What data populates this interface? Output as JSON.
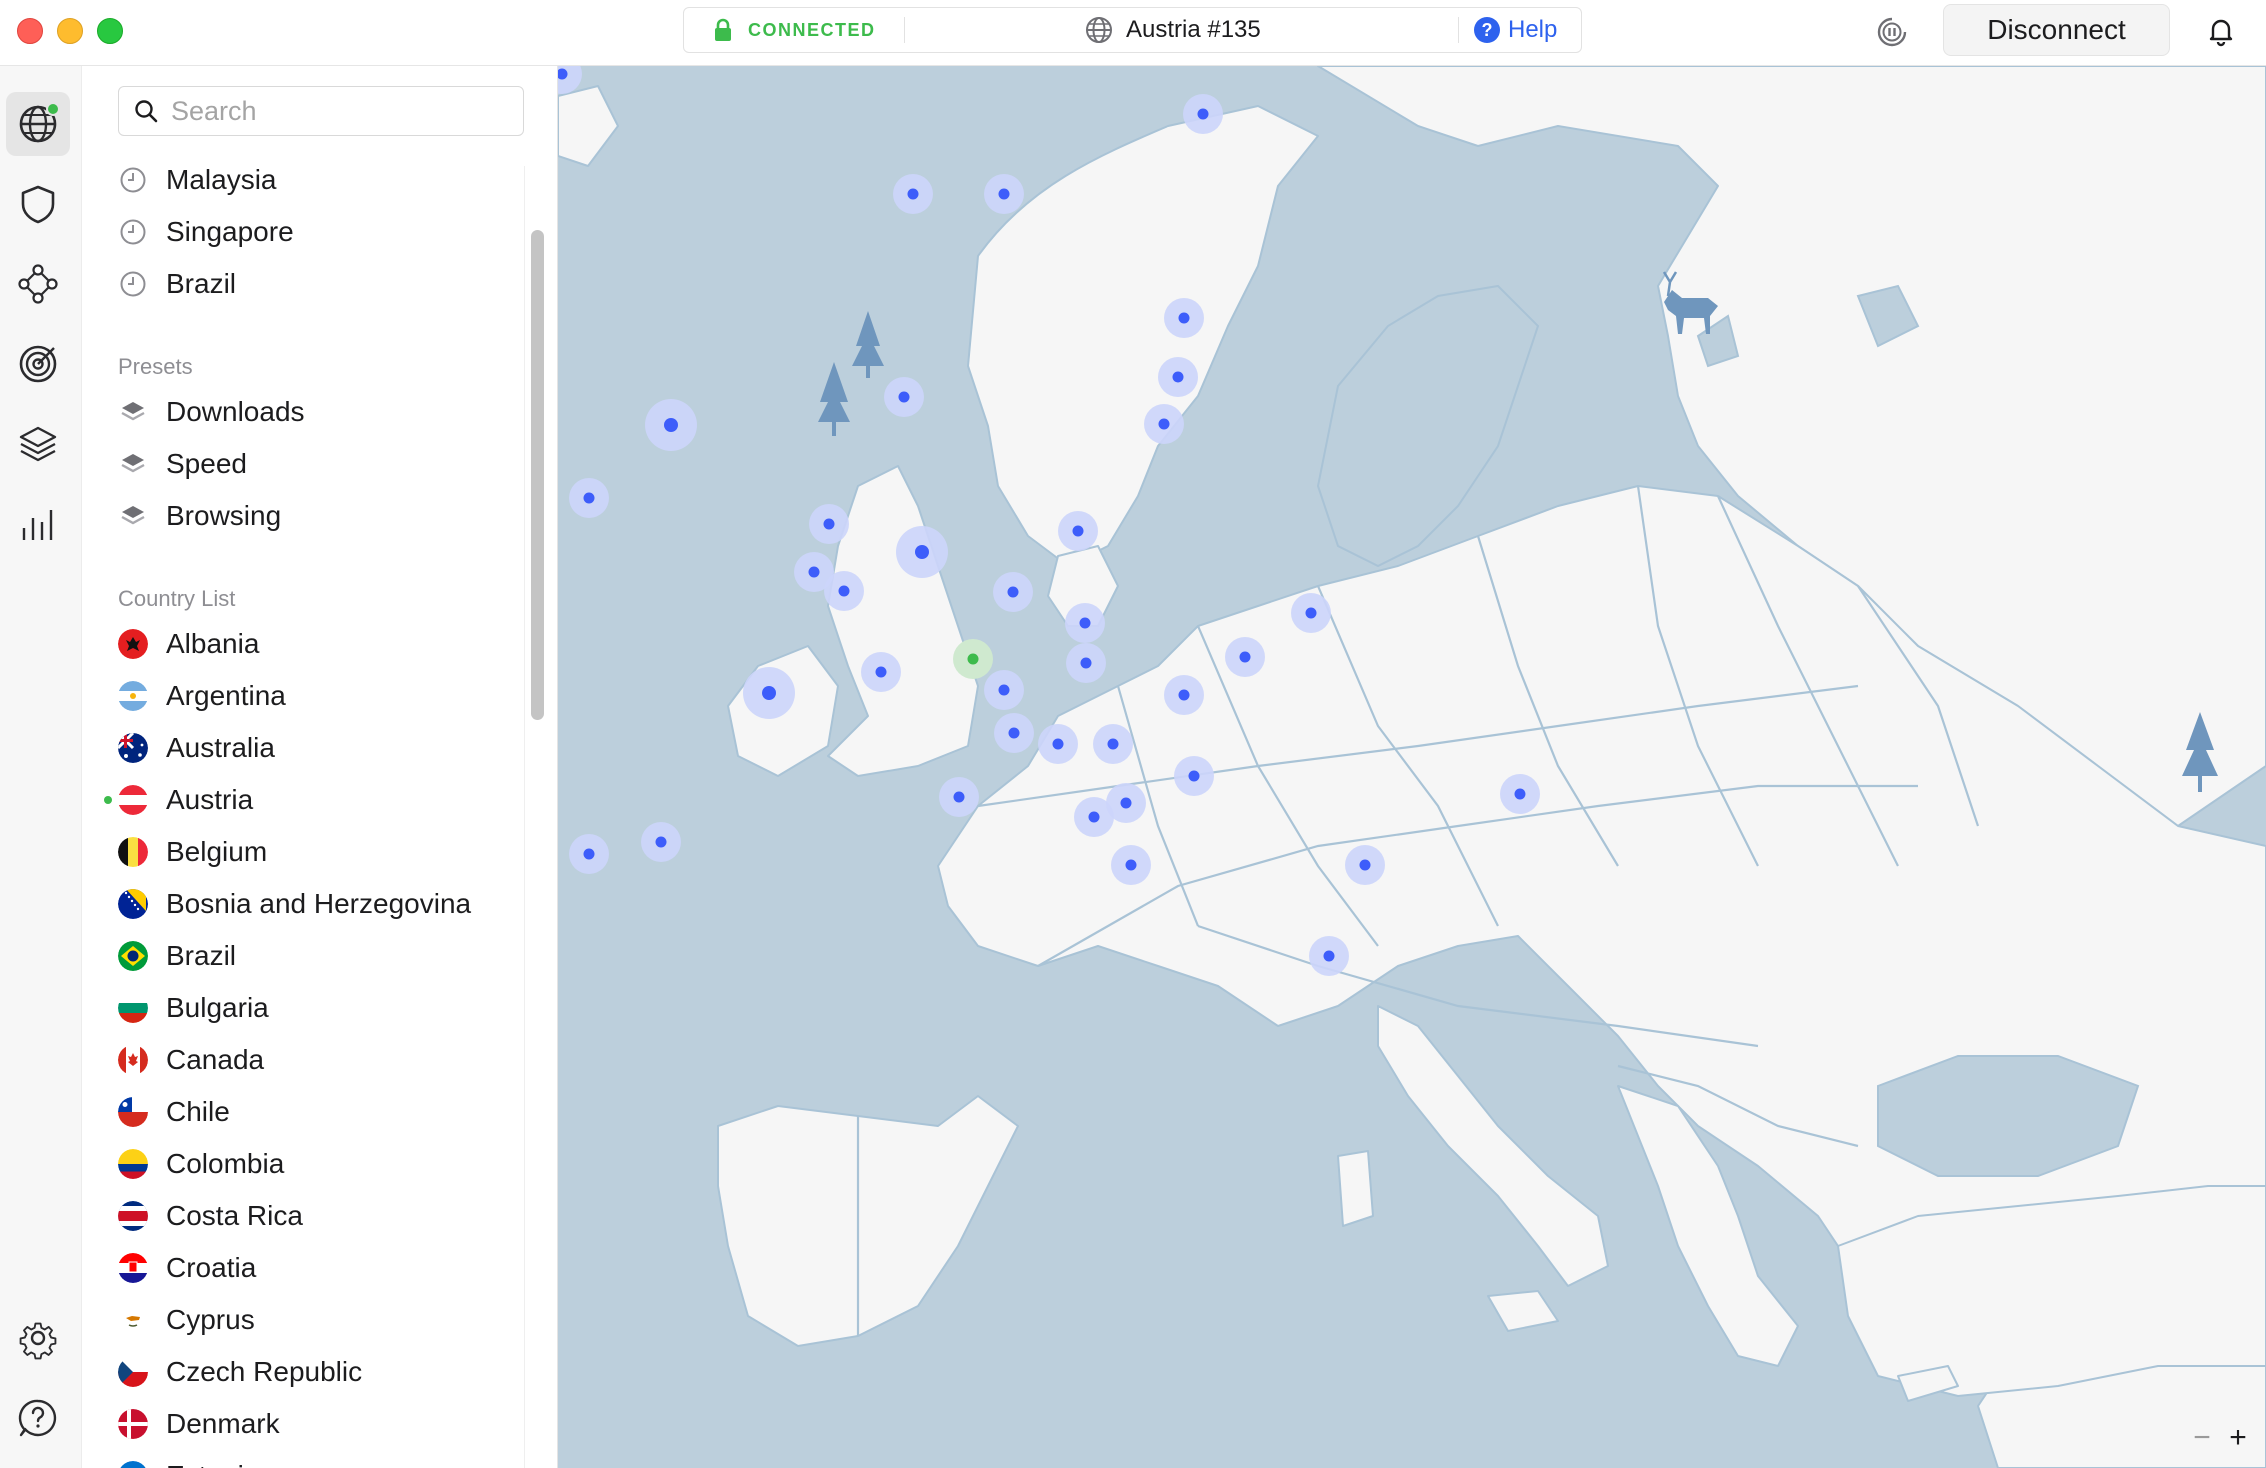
{
  "window": {
    "status_label": "CONNECTED",
    "server_name": "Austria #135",
    "help_label": "Help",
    "disconnect_label": "Disconnect"
  },
  "rail": {
    "items": [
      "globe-icon",
      "shield-icon",
      "meshnet-icon",
      "target-icon",
      "layers-icon",
      "stats-icon"
    ],
    "bottom": [
      "gear-icon",
      "help-icon"
    ]
  },
  "search": {
    "placeholder": "Search",
    "value": ""
  },
  "recent": [
    {
      "label": "Malaysia"
    },
    {
      "label": "Singapore"
    },
    {
      "label": "Brazil"
    }
  ],
  "presets_title": "Presets",
  "presets": [
    {
      "label": "Downloads"
    },
    {
      "label": "Speed"
    },
    {
      "label": "Browsing"
    }
  ],
  "country_list_title": "Country List",
  "countries": [
    {
      "label": "Albania",
      "flag": "al"
    },
    {
      "label": "Argentina",
      "flag": "ar"
    },
    {
      "label": "Australia",
      "flag": "au"
    },
    {
      "label": "Austria",
      "flag": "at",
      "connected": true
    },
    {
      "label": "Belgium",
      "flag": "be"
    },
    {
      "label": "Bosnia and Herzegovina",
      "flag": "ba"
    },
    {
      "label": "Brazil",
      "flag": "br"
    },
    {
      "label": "Bulgaria",
      "flag": "bg"
    },
    {
      "label": "Canada",
      "flag": "ca"
    },
    {
      "label": "Chile",
      "flag": "cl"
    },
    {
      "label": "Colombia",
      "flag": "co"
    },
    {
      "label": "Costa Rica",
      "flag": "cr"
    },
    {
      "label": "Croatia",
      "flag": "hr"
    },
    {
      "label": "Cyprus",
      "flag": "cy"
    },
    {
      "label": "Czech Republic",
      "flag": "cz"
    },
    {
      "label": "Denmark",
      "flag": "dk"
    },
    {
      "label": "Estonia",
      "flag": "ee"
    }
  ],
  "colors": {
    "accent": "#2e62ee",
    "connected": "#3dbb4c",
    "map_water": "#bccfdc",
    "map_land": "#f6f6f6",
    "map_border": "#a9c3d6",
    "server_dot": "#3d5dfa",
    "server_halo": "#ccd5fb"
  }
}
